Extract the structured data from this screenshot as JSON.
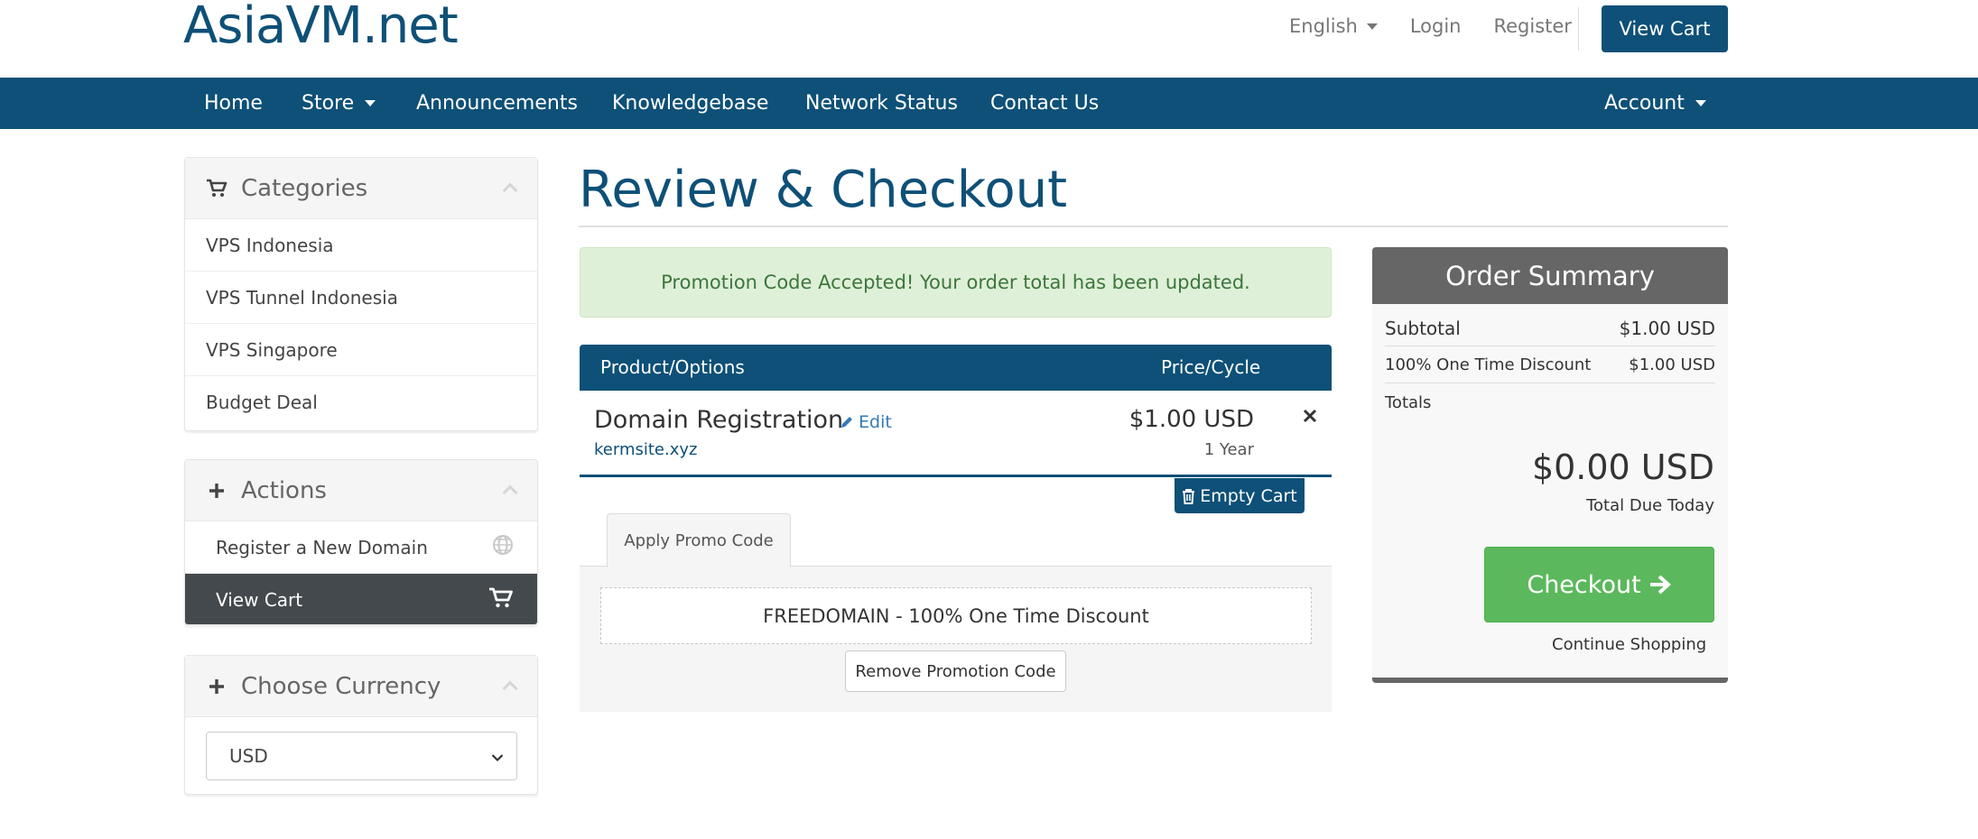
{
  "header": {
    "brand": "AsiaVM.net",
    "language": "English",
    "login": "Login",
    "register": "Register",
    "view_cart": "View Cart"
  },
  "nav": {
    "home": "Home",
    "store": "Store",
    "announcements": "Announcements",
    "knowledgebase": "Knowledgebase",
    "network_status": "Network Status",
    "contact_us": "Contact Us",
    "account": "Account"
  },
  "sidebar": {
    "categories": {
      "title": "Categories",
      "items": [
        "VPS Indonesia",
        "VPS Tunnel Indonesia",
        "VPS Singapore",
        "Budget Deal"
      ]
    },
    "actions": {
      "title": "Actions",
      "register_domain": "Register a New Domain",
      "view_cart": "View Cart"
    },
    "currency": {
      "title": "Choose Currency",
      "selected": "USD"
    }
  },
  "main": {
    "title": "Review & Checkout",
    "alert": "Promotion Code Accepted! Your order total has been updated.",
    "table": {
      "col_product": "Product/Options",
      "col_price": "Price/Cycle"
    },
    "item": {
      "name": "Domain Registration",
      "edit": "Edit",
      "domain": "kermsite.xyz",
      "price": "$1.00 USD",
      "cycle": "1 Year"
    },
    "empty_cart": "Empty Cart",
    "promo": {
      "tab": "Apply Promo Code",
      "applied": "FREEDOMAIN - 100% One Time Discount",
      "remove": "Remove Promotion Code"
    }
  },
  "summary": {
    "title": "Order Summary",
    "subtotal_label": "Subtotal",
    "subtotal_value": "$1.00 USD",
    "discount_label": "100% One Time Discount",
    "discount_value": "$1.00 USD",
    "totals_label": "Totals",
    "total_due": "$0.00 USD",
    "total_due_label": "Total Due Today",
    "checkout": "Checkout",
    "continue": "Continue Shopping"
  },
  "colors": {
    "primary": "#0e5077",
    "success": "#5cb85c",
    "alert_bg": "#dff0d8",
    "summary_head": "#666666"
  }
}
